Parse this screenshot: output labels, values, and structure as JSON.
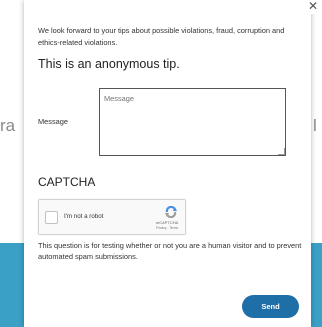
{
  "background": {
    "text_left": "ra",
    "text_right": "l",
    "band_color": "#3aa0c6"
  },
  "modal": {
    "close_icon": "close-icon",
    "close_glyph": "✕",
    "intro_text": "We look forward to your tips about possible violations, fraud, corruption and ethics-related violations.",
    "heading": "This is an anonymous tip.",
    "message_label": "Message",
    "message_placeholder": "Message",
    "message_value": "",
    "captcha_title": "CAPTCHA",
    "recaptcha": {
      "checkbox_label": "I'm not a robot",
      "checked": false,
      "brand": "reCAPTCHA",
      "terms": "Privacy - Terms",
      "logo_icon": "recaptcha-logo-icon"
    },
    "captcha_note": "This question is for testing whether or not you are a human visitor and to prevent automated spam submissions.",
    "send_label": "Send"
  },
  "colors": {
    "send_button": "#1e6fa8",
    "accent_band": "#3aa0c6"
  }
}
